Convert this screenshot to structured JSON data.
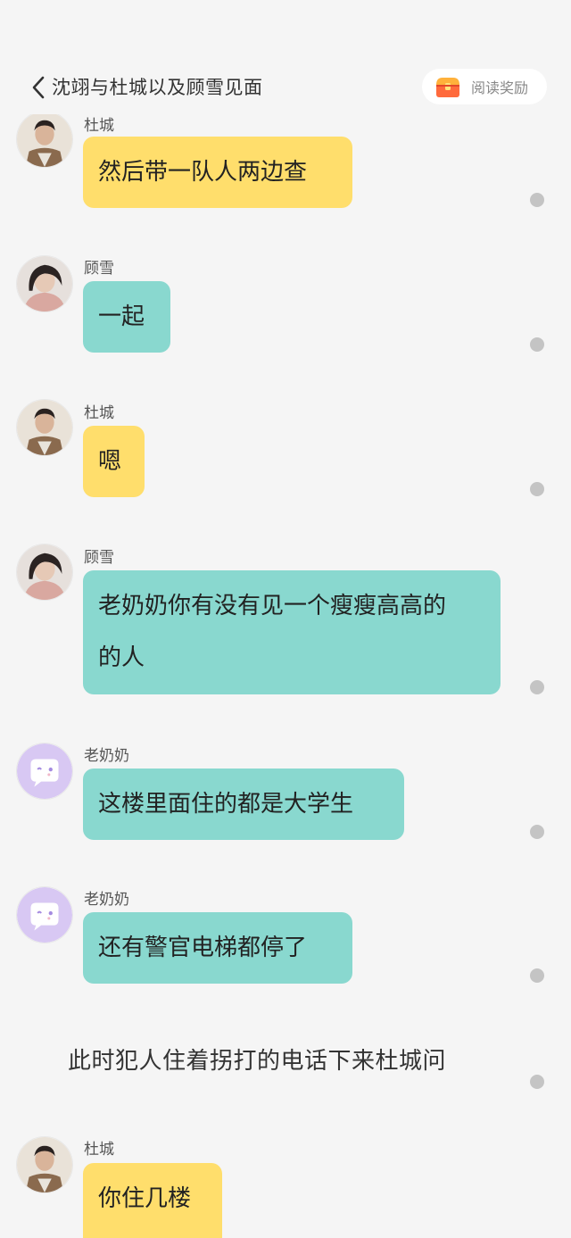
{
  "header": {
    "title": "沈翊与杜城以及顾雪见面",
    "reward_label": "阅读奖励"
  },
  "colors": {
    "yellow_bubble": "#ffde6c",
    "teal_bubble": "#89d8cf",
    "background": "#f5f5f5"
  },
  "messages": [
    {
      "name": "杜城",
      "text": "然后带一队人两边查",
      "bubble": "yellow",
      "avatar": "man-avatar"
    },
    {
      "name": "顾雪",
      "text": "一起",
      "bubble": "teal",
      "avatar": "woman-avatar"
    },
    {
      "name": "杜城",
      "text": "嗯",
      "bubble": "yellow",
      "avatar": "man-avatar"
    },
    {
      "name": "顾雪",
      "text_line1": "老奶奶你有没有见一个瘦瘦高高的",
      "text_line2": "的人",
      "bubble": "teal",
      "avatar": "woman-avatar"
    },
    {
      "name": "老奶奶",
      "text": "这楼里面住的都是大学生",
      "bubble": "teal",
      "avatar": "chat-bubble-avatar"
    },
    {
      "name": "老奶奶",
      "text": "还有警官电梯都停了",
      "bubble": "teal",
      "avatar": "chat-bubble-avatar"
    },
    {
      "name": "杜城",
      "text": "你住几楼",
      "bubble": "yellow",
      "avatar": "man-avatar"
    }
  ],
  "narration": "此时犯人住着拐打的电话下来杜城问"
}
